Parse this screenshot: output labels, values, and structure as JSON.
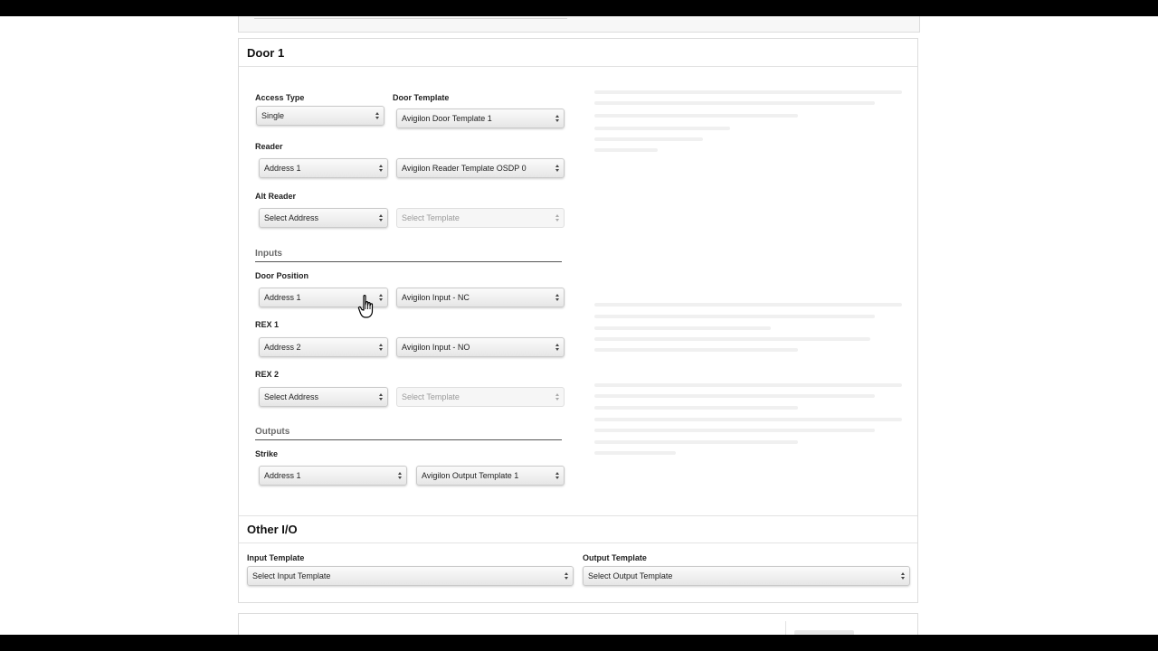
{
  "door": {
    "title": "Door 1",
    "access_type": {
      "label": "Access Type",
      "value": "Single"
    },
    "door_template": {
      "label": "Door Template",
      "value": "Avigilon Door Template 1"
    },
    "reader": {
      "label": "Reader",
      "address": "Address 1",
      "template": "Avigilon Reader Template OSDP 0"
    },
    "alt_reader": {
      "label": "Alt Reader",
      "address": "Select Address",
      "template": "Select Template"
    },
    "inputs": {
      "heading": "Inputs",
      "door_position": {
        "label": "Door Position",
        "address": "Address 1",
        "template": "Avigilon Input - NC"
      },
      "rex1": {
        "label": "REX 1",
        "address": "Address 2",
        "template": "Avigilon Input - NO"
      },
      "rex2": {
        "label": "REX 2",
        "address": "Select Address",
        "template": "Select Template"
      }
    },
    "outputs": {
      "heading": "Outputs",
      "strike": {
        "label": "Strike",
        "address": "Address 1",
        "template": "Avigilon Output Template 1"
      }
    }
  },
  "other_io": {
    "title": "Other I/O",
    "input_template": {
      "label": "Input Template",
      "value": "Select Input Template"
    },
    "output_template": {
      "label": "Output Template",
      "value": "Select Output Template"
    }
  },
  "icons": {
    "select_arrows": "up-down-arrows-icon",
    "cursor": "hand-pointer-icon"
  }
}
